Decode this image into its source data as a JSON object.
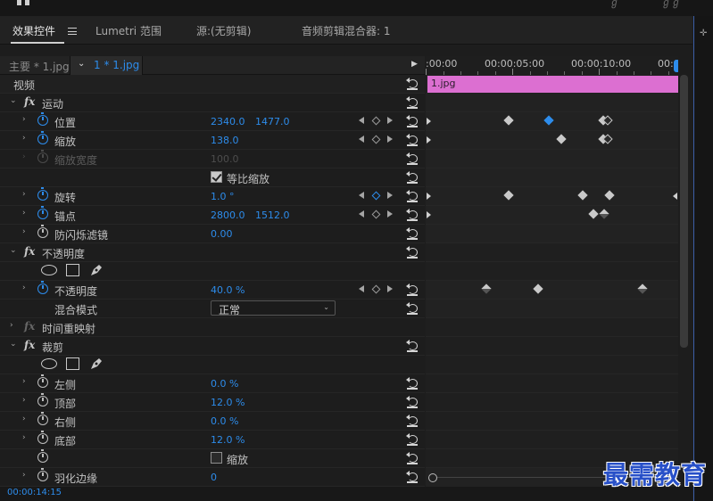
{
  "tabs": [
    {
      "label": "效果控件",
      "active": true
    },
    {
      "label": "Lumetri 范围"
    },
    {
      "label": "源:(无剪辑)"
    },
    {
      "label": "音频剪辑混合器: 1"
    }
  ],
  "sequence": {
    "main": "主要 * 1.jpg",
    "sub": "1 * 1.jpg"
  },
  "ruler": {
    "labels": [
      ":00:00",
      "00:00:05:00",
      "00:00:10:00",
      "00:0"
    ]
  },
  "clip": {
    "name": "1.jpg",
    "color": "#dc6fd1"
  },
  "video_header": "视频",
  "motion": {
    "title": "运动",
    "position": {
      "label": "位置",
      "x": "2340.0",
      "y": "1477.0"
    },
    "scale": {
      "label": "缩放",
      "value": "138.0"
    },
    "scale_width": {
      "label": "缩放宽度",
      "value": "100.0"
    },
    "uniform_scale": {
      "label": "等比缩放",
      "checked": true
    },
    "rotation": {
      "label": "旋转",
      "value": "1.0 °"
    },
    "anchor": {
      "label": "锚点",
      "x": "2800.0",
      "y": "1512.0"
    },
    "antiflicker": {
      "label": "防闪烁滤镜",
      "value": "0.00"
    }
  },
  "opacity": {
    "title": "不透明度",
    "opacity": {
      "label": "不透明度",
      "value": "40.0 %"
    },
    "blend": {
      "label": "混合模式",
      "value": "正常"
    }
  },
  "time_remap": {
    "title": "时间重映射"
  },
  "crop": {
    "title": "裁剪",
    "left": {
      "label": "左侧",
      "value": "0.0 %"
    },
    "top": {
      "label": "顶部",
      "value": "12.0 %"
    },
    "right": {
      "label": "右侧",
      "value": "0.0 %"
    },
    "bottom": {
      "label": "底部",
      "value": "12.0 %"
    },
    "zoom": {
      "label": "缩放",
      "checked": false
    },
    "feather": {
      "label": "羽化边缘",
      "value": "0"
    }
  },
  "footer": {
    "timecode": "00:00:14:15"
  },
  "watermark": "最需教育",
  "colors": {
    "accent": "#2d8ceb",
    "clip": "#dc6fd1",
    "watermark": "#2850c8"
  }
}
